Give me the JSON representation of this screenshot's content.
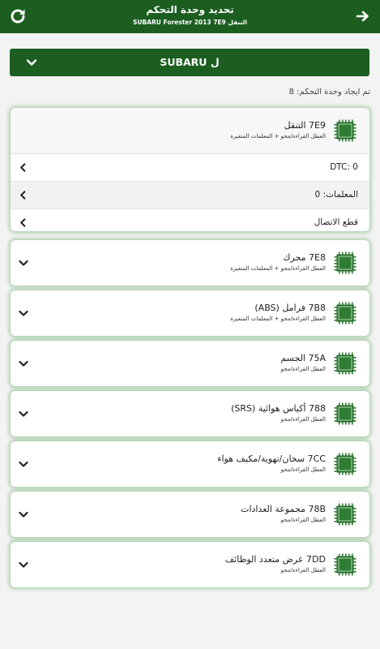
{
  "header": {
    "title": "تحديد وحدة التحكم",
    "subtitle": "SUBARU Forester 2013 7E9 التنقل"
  },
  "brand_select": {
    "label": "SUBARU ل"
  },
  "count_text": "تم ايجاد وحدة التحكم: 8",
  "units": [
    {
      "name": "7E9 التنقل",
      "desc": "العطل القراءة/محو + المعلمات المتغيرة",
      "rows": [
        "DTC: 0",
        "المعلمات: 0",
        "قطع الاتصال"
      ]
    },
    {
      "name": "7E8 محرك",
      "desc": "العطل القراءة/محو + المعلمات المتغيرة"
    },
    {
      "name": "7B8 فرامل (ABS)",
      "desc": "العطل القراءة/محو + المعلمات المتغيرة"
    },
    {
      "name": "75A الجسم",
      "desc": "العطل القراءة/محو"
    },
    {
      "name": "788 أكياس هوائية (SRS)",
      "desc": "العطل القراءة/محو"
    },
    {
      "name": "7CC سخان/تهوية/مكيف هواء",
      "desc": "العطل القراءة/محو"
    },
    {
      "name": "78B مجموعة العدادات",
      "desc": "العطل القراءة/محو"
    },
    {
      "name": "7DD عرض متعدد الوظائف",
      "desc": "العطل القراءة/محو"
    }
  ],
  "icons": {
    "refresh": "refresh-icon",
    "forward": "arrow-right-icon",
    "ecu": "ecu-chip-icon",
    "expand": "chevron-down-icon",
    "open": "chevron-left-icon"
  },
  "colors": {
    "primary": "#1b5e20",
    "ecu_fill": "#2e7d32",
    "background": "#f3f3f3"
  }
}
